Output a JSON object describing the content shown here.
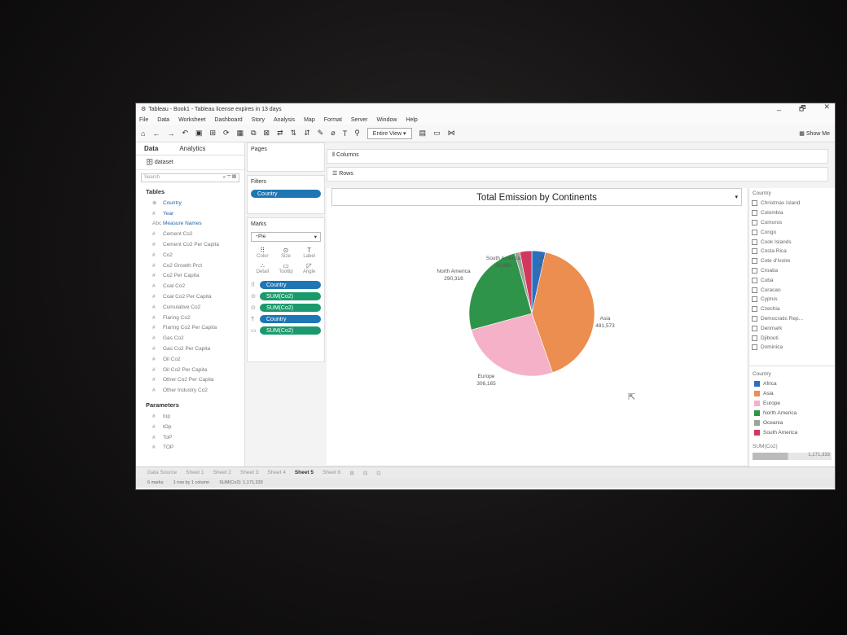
{
  "window": {
    "title": "Tableau - Book1 - Tableau license expires in 13 days",
    "controls": [
      "_",
      "🗗",
      "✕"
    ]
  },
  "menu": [
    "File",
    "Data",
    "Worksheet",
    "Dashboard",
    "Story",
    "Analysis",
    "Map",
    "Format",
    "Server",
    "Window",
    "Help"
  ],
  "toolbar": {
    "view_mode": "Entire View",
    "show_me": "Show Me"
  },
  "data_pane": {
    "tab_data": "Data",
    "tab_analytics": "Analytics",
    "datasource": "dataset",
    "search_placeholder": "Search",
    "tables_header": "Tables",
    "fields": [
      {
        "icon": "⊕",
        "name": "Country"
      },
      {
        "icon": "#",
        "name": "Year"
      },
      {
        "icon": "Abc",
        "name": "Measure Names"
      },
      {
        "icon": "#",
        "name": "Cement Co2"
      },
      {
        "icon": "#",
        "name": "Cement Co2 Per Capita"
      },
      {
        "icon": "#",
        "name": "Co2"
      },
      {
        "icon": "#",
        "name": "Co2 Growth Prct"
      },
      {
        "icon": "#",
        "name": "Co2 Per Capita"
      },
      {
        "icon": "#",
        "name": "Coal Co2"
      },
      {
        "icon": "#",
        "name": "Coal Co2 Per Capita"
      },
      {
        "icon": "#",
        "name": "Cumulative Co2"
      },
      {
        "icon": "#",
        "name": "Flaring Co2"
      },
      {
        "icon": "#",
        "name": "Flaring Co2 Per Capita"
      },
      {
        "icon": "#",
        "name": "Gas Co2"
      },
      {
        "icon": "#",
        "name": "Gas Co2 Per Capita"
      },
      {
        "icon": "#",
        "name": "Oil Co2"
      },
      {
        "icon": "#",
        "name": "Oil Co2 Per Capita"
      },
      {
        "icon": "#",
        "name": "Other Co2 Per Capita"
      },
      {
        "icon": "#",
        "name": "Other Industry Co2"
      }
    ],
    "parameters_header": "Parameters",
    "parameters": [
      "top",
      "tOp",
      "ToP",
      "TOP"
    ]
  },
  "cards": {
    "pages": "Pages",
    "filters": "Filters",
    "filter_pill": "Country",
    "marks": "Marks",
    "mark_type": "Pie",
    "mark_buttons": [
      "Color",
      "Size",
      "Label",
      "Detail",
      "Tooltip",
      "Angle"
    ],
    "mark_pills": [
      {
        "label": "Country",
        "color": "blue"
      },
      {
        "label": "SUM(Co2)",
        "color": "green"
      },
      {
        "label": "SUM(Co2)",
        "color": "green"
      },
      {
        "label": "Country",
        "color": "blue"
      },
      {
        "label": "SUM(Co2)",
        "color": "green"
      }
    ]
  },
  "shelves": {
    "columns": "Columns",
    "rows": "Rows"
  },
  "chart_data": {
    "type": "pie",
    "title": "Total Emission by Continents",
    "slices": [
      {
        "label": "Africa",
        "value": 40923,
        "display": "40,923",
        "color": "#2e6fbd"
      },
      {
        "label": "Asia",
        "value": 481573,
        "display": "481,573",
        "color": "#eb8e50"
      },
      {
        "label": "Europe",
        "value": 306165,
        "display": "306,165",
        "color": "#f4b1c8"
      },
      {
        "label": "North America",
        "value": 290316,
        "display": "290,316",
        "color": "#2e9449"
      },
      {
        "label": "Oceania",
        "value": 16000,
        "display": "",
        "color": "#9aa59a"
      },
      {
        "label": "South America",
        "value": 35880,
        "display": "35,880",
        "color": "#d2385e"
      }
    ]
  },
  "right_pane": {
    "filter_title": "Country",
    "countries": [
      "Christmas Island",
      "Colombia",
      "Comoros",
      "Congo",
      "Cook Islands",
      "Costa Rica",
      "Cote d'Ivoire",
      "Croatia",
      "Cuba",
      "Curacao",
      "Cyprus",
      "Czechia",
      "Democratic Rep...",
      "Denmark",
      "Djibouti",
      "Dominica"
    ],
    "legend_title": "Country",
    "legend": [
      {
        "label": "Africa",
        "color": "#2e6fbd"
      },
      {
        "label": "Asia",
        "color": "#eb8e50"
      },
      {
        "label": "Europe",
        "color": "#f4b1c8"
      },
      {
        "label": "North America",
        "color": "#2e9449"
      },
      {
        "label": "Oceania",
        "color": "#9aa59a"
      },
      {
        "label": "South America",
        "color": "#d2385e"
      }
    ],
    "size_title": "SUM(Co2)",
    "size_value": "1,171,333"
  },
  "tabs": [
    "Data Source",
    "Sheet 1",
    "Sheet 2",
    "Sheet 3",
    "Sheet 4",
    "Sheet 5",
    "Sheet 6"
  ],
  "active_tab": "Sheet 5",
  "status": [
    "6 marks",
    "1 row by 1 column",
    "SUM(Co2): 1,171,333"
  ]
}
